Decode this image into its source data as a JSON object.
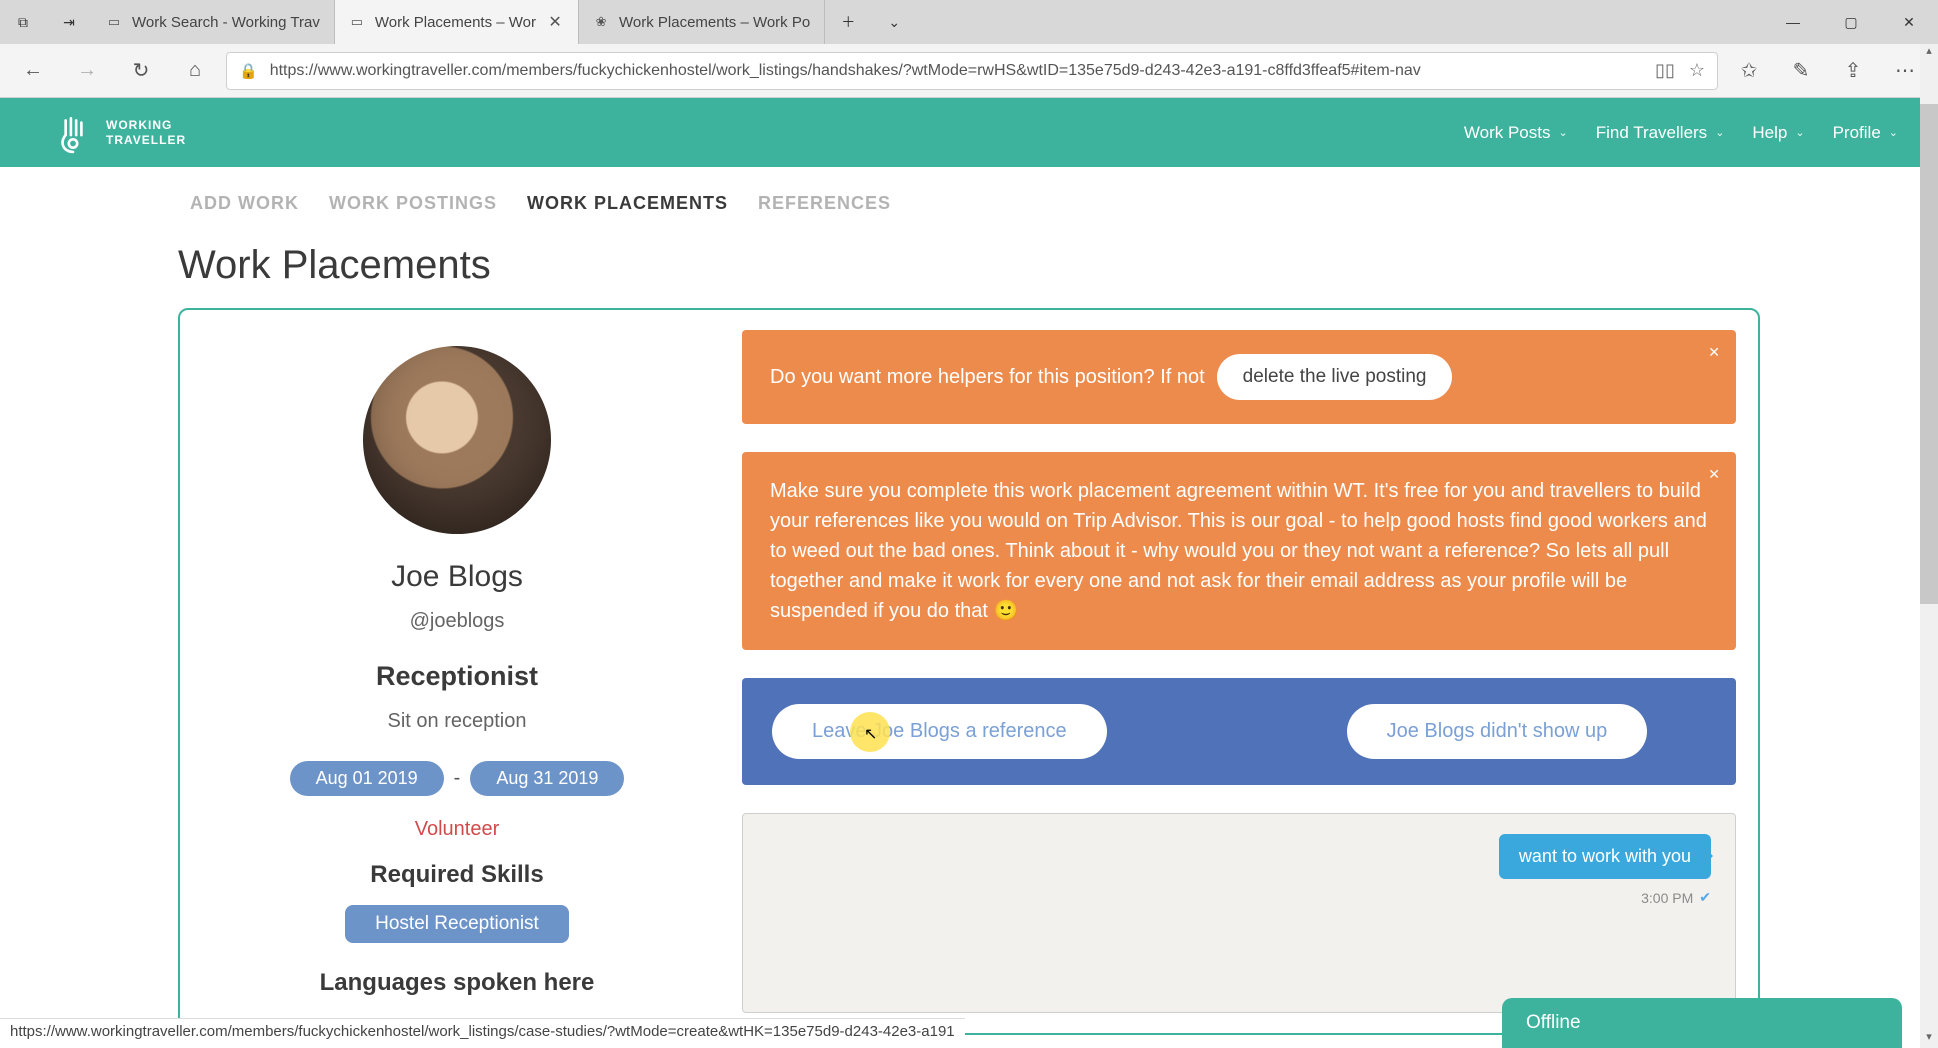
{
  "browser": {
    "tabs": [
      {
        "title": "Work Search - Working Trav"
      },
      {
        "title": "Work Placements – Wor"
      },
      {
        "title": "Work Placements – Work Po"
      }
    ],
    "active_tab_index": 1,
    "url": "https://www.workingtraveller.com/members/fuckychickenhostel/work_listings/handshakes/?wtMode=rwHS&wtID=135e75d9-d243-42e3-a191-c8ffd3ffeaf5#item-nav",
    "status_url": "https://www.workingtraveller.com/members/fuckychickenhostel/work_listings/case-studies/?wtMode=create&wtHK=135e75d9-d243-42e3-a191"
  },
  "header": {
    "brand_line1": "WORKING",
    "brand_line2": "TRAVELLER",
    "nav": [
      "Work Posts",
      "Find Travellers",
      "Help",
      "Profile"
    ]
  },
  "subtabs": {
    "items": [
      "ADD WORK",
      "WORK POSTINGS",
      "WORK PLACEMENTS",
      "REFERENCES"
    ],
    "active_index": 2
  },
  "page": {
    "title": "Work Placements"
  },
  "profile": {
    "name": "Joe Blogs",
    "handle": "@joeblogs",
    "role": "Receptionist",
    "description": "Sit on reception",
    "date_start": "Aug 01 2019",
    "date_end": "Aug 31 2019",
    "type": "Volunteer",
    "skills_label": "Required Skills",
    "skill": "Hostel Receptionist",
    "lang_label": "Languages spoken here"
  },
  "alerts": {
    "a1_text": "Do you want more helpers for this position? If not",
    "a1_button": "delete the live posting",
    "a2_text": "Make sure you complete this work placement agreement within WT. It's free for you and travellers to build your references like you would on Trip Advisor. This is our goal - to help good hosts find good workers and to weed out the bad ones. Think about it - why would you or they not want a reference? So lets all pull together and make it work for every one and not ask for their email address as your profile will be suspended if you do that 🙂"
  },
  "actions": {
    "leave_ref": "Leave Joe Blogs a reference",
    "no_show": "Joe Blogs didn't show up"
  },
  "chat": {
    "bubble": "want to work with you",
    "time": "3:00 PM"
  },
  "offline": {
    "label": "Offline"
  }
}
